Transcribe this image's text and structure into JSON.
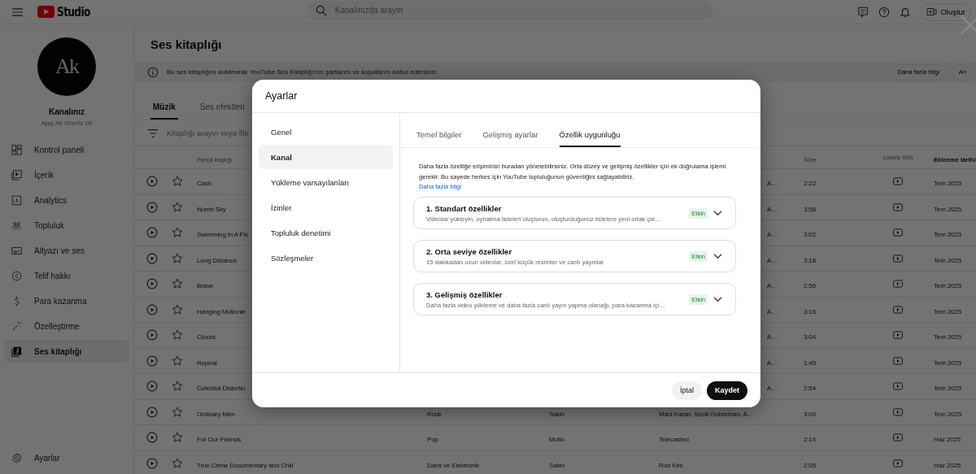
{
  "topbar": {
    "logo": "Studio",
    "search_placeholder": "Kanalınızda arayın",
    "create_button": "Oluştur"
  },
  "sidebar": {
    "avatar_text": "Ak",
    "channel_title": "Kanalınız",
    "channel_name": "Ajay Ak Shorts 09",
    "items": [
      {
        "label": "Kontrol paneli",
        "selected": false
      },
      {
        "label": "İçerik",
        "selected": false
      },
      {
        "label": "Analytics",
        "selected": false
      },
      {
        "label": "Topluluk",
        "selected": false
      },
      {
        "label": "Altyazı ve ses",
        "selected": false
      },
      {
        "label": "Telif hakkı",
        "selected": false
      },
      {
        "label": "Para kazanma",
        "selected": false
      },
      {
        "label": "Özelleştirme",
        "selected": false
      },
      {
        "label": "Ses kitaplığı",
        "selected": true
      }
    ],
    "settings": "Ayarlar"
  },
  "page": {
    "title": "Ses kitaplığı",
    "banner": {
      "text": "Bu ses kitaplığını kullanarak YouTube Ses Kitaplığı'nın şartlarını ve koşullarını kabul edersiniz.",
      "buttons": [
        "Daha fazla bilgi",
        "An"
      ]
    },
    "tabs": [
      {
        "label": "Müzik",
        "selected": true
      },
      {
        "label": "Ses efektleri",
        "selected": false
      }
    ],
    "filter_placeholder": "Kitaplığı arayın veya filtr",
    "table": {
      "columns": {
        "title": "Parça başlığı",
        "duration": "Süre",
        "license": "Lisans türü",
        "date": "Eklenme tarihi"
      },
      "rows": [
        {
          "title": "Cash",
          "artist": "A…",
          "duration": "2:22",
          "date": "Tem 2025"
        },
        {
          "title": "Numb Sky",
          "artist": "A…",
          "duration": "3:58",
          "date": "Tem 2025"
        },
        {
          "title": "Swimming In A Fis",
          "artist": "A…",
          "duration": "3:02",
          "date": "Tem 2025"
        },
        {
          "title": "Long Distance",
          "artist": "A…",
          "duration": "3:18",
          "date": "Tem 2025"
        },
        {
          "title": "Brave",
          "artist": "A…",
          "duration": "2:56",
          "date": "Tem 2025"
        },
        {
          "title": "Hanging Motionle",
          "artist": "A…",
          "duration": "3:16",
          "date": "Tem 2025"
        },
        {
          "title": "Clocks",
          "artist": "A…",
          "duration": "3:04",
          "date": "Tem 2025"
        },
        {
          "title": "Repeat",
          "artist": "A…",
          "duration": "1:45",
          "date": "Tem 2025"
        },
        {
          "title": "Celestial Distortio",
          "artist": "A…",
          "duration": "2:54",
          "date": "Tem 2025"
        },
        {
          "title": "Ordinary Men",
          "genre": "Rock",
          "mood": "Sakin",
          "artist": "Mani Karan, Scott Guberman, A…",
          "duration": "3:00",
          "date": "Tem 2025"
        },
        {
          "title": "For Our Friends",
          "genre": "Pop",
          "mood": "Mutlu",
          "artist": "Telecasted",
          "duration": "2:14",
          "date": "Haz 2025"
        },
        {
          "title": "True Crime Documentary and Chill",
          "genre": "Dans ve Elektronik",
          "mood": "Sakin",
          "artist": "Rod Kim",
          "duration": "2:05",
          "date": "Haz 2025"
        }
      ]
    }
  },
  "dialog": {
    "title": "Ayarlar",
    "nav": [
      {
        "label": "Genel",
        "selected": false
      },
      {
        "label": "Kanal",
        "selected": true
      },
      {
        "label": "Yükleme varsayılanları",
        "selected": false
      },
      {
        "label": "İzinler",
        "selected": false
      },
      {
        "label": "Topluluk denetimi",
        "selected": false
      },
      {
        "label": "Sözleşmeler",
        "selected": false
      }
    ],
    "tabs": [
      {
        "label": "Temel bilgiler",
        "selected": false
      },
      {
        "label": "Gelişmiş ayarlar",
        "selected": false
      },
      {
        "label": "Özellik uygunluğu",
        "selected": true
      }
    ],
    "description": "Daha fazla özelliğe erişiminizi buradan yönetebilirsiniz. Orta düzey ve gelişmiş özellikler için ek doğrulama işlemi gerekir. Bu sayede herkes için YouTube topluluğunun güvenliğini sağlayabiliriz.",
    "link": "Daha fazla bilgi",
    "features": [
      {
        "title": "1. Standart özellikler",
        "description": "Videolar yükleyin, oynatma listeleri oluşturun, oluşturduğunuz listelere yeni ortak çal…",
        "status": "Etkin",
        "enabled": true
      },
      {
        "title": "2. Orta seviye özellikler",
        "description": "15 dakikadan uzun videolar, özel küçük resimler ve canlı yayınlar",
        "status": "Etkin",
        "enabled": true
      },
      {
        "title": "3. Gelişmiş özellikler",
        "description": "Daha fazla video yükleme ve daha fazla canlı yayın yapma olanağı, para kazanma içi…",
        "status": "Etkin",
        "enabled": true
      }
    ],
    "buttons": {
      "cancel": "İptal",
      "save": "Kaydet"
    }
  }
}
